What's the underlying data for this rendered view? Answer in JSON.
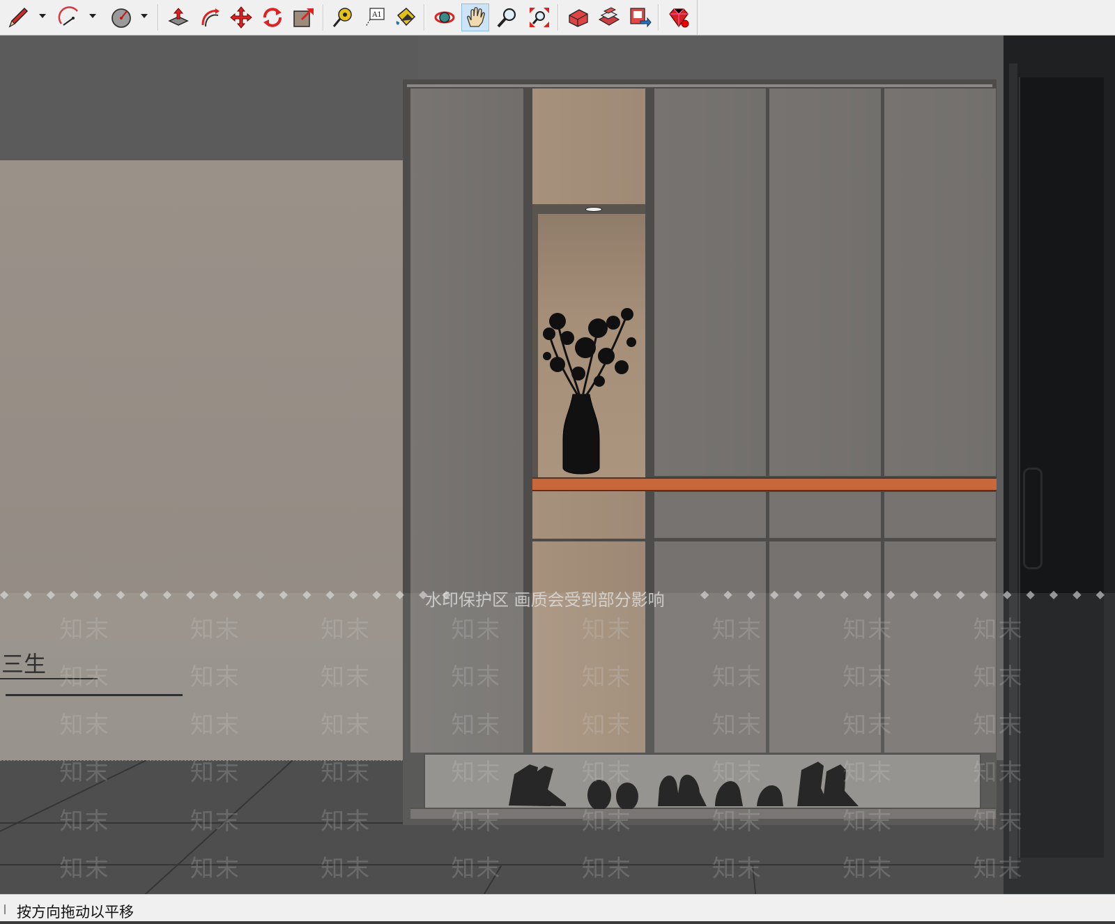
{
  "toolbar": {
    "buttons": [
      {
        "name": "pencil-tool",
        "icon": "pencil-icon",
        "has_dropdown": true
      },
      {
        "name": "arc-tool",
        "icon": "arc-icon",
        "has_dropdown": true
      },
      {
        "name": "paint-tool",
        "icon": "paint-bucket-icon",
        "has_dropdown": true
      },
      {
        "name": "push-pull-tool",
        "icon": "push-pull-icon"
      },
      {
        "name": "follow-me-tool",
        "icon": "follow-me-icon"
      },
      {
        "name": "move-tool",
        "icon": "move-icon"
      },
      {
        "name": "rotate-tool",
        "icon": "rotate-icon"
      },
      {
        "name": "scale-tool",
        "icon": "scale-icon"
      },
      {
        "name": "tape-measure-tool",
        "icon": "tape-measure-icon"
      },
      {
        "name": "text-tool",
        "icon": "text-icon",
        "label": "A1"
      },
      {
        "name": "paint-bucket-tool",
        "icon": "paint-icon"
      },
      {
        "name": "orbit-tool",
        "icon": "orbit-icon"
      },
      {
        "name": "pan-tool",
        "icon": "hand-icon",
        "active": true
      },
      {
        "name": "zoom-tool",
        "icon": "zoom-icon"
      },
      {
        "name": "zoom-extents-tool",
        "icon": "zoom-extents-icon"
      },
      {
        "name": "warehouse-tool",
        "icon": "warehouse-icon"
      },
      {
        "name": "components-tool",
        "icon": "components-icon"
      },
      {
        "name": "share-model-tool",
        "icon": "share-icon"
      },
      {
        "name": "ruby-console-tool",
        "icon": "ruby-icon"
      }
    ],
    "text_icon_label": "A1"
  },
  "viewport": {
    "wall_text": "三生",
    "watermark_notice": "水印保护区 画质会受到部分影响",
    "watermark_word": "知末",
    "colors": {
      "ceiling": "#5b5b5b",
      "wall": "#9c948b",
      "cabinet_door": "#767370",
      "cabinet_frame": "#4d4c4a",
      "wood": "#a58e78",
      "shelf_accent": "#c8683a",
      "floor": "#3e3e40",
      "door": "#222426"
    }
  },
  "status": {
    "text": "按方向拖动以平移"
  }
}
